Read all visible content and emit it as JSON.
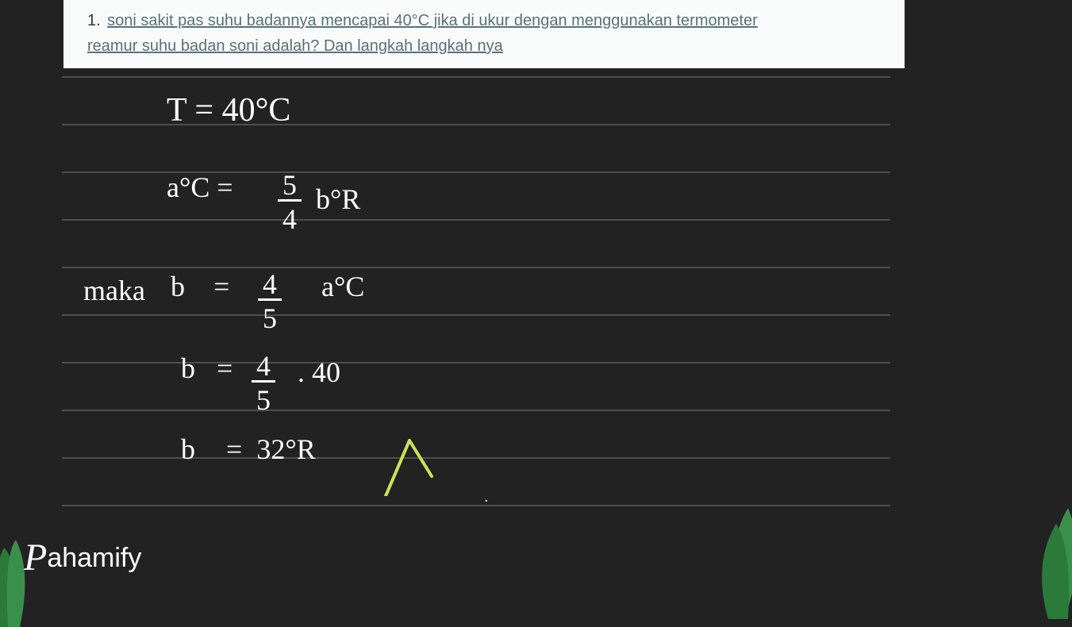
{
  "question": {
    "number": "1.",
    "text_line1": "soni sakit pas suhu badannya mencapai 40°C jika di ukur dengan menggunakan termometer",
    "text_line2": "reamur suhu badan soni adalah? Dan langkah langkah nya"
  },
  "work": {
    "given": "T = 40°C",
    "formula_lhs": "a°C =",
    "formula_frac_num": "5",
    "formula_frac_den": "4",
    "formula_rhs": "b°R",
    "then_label": "maka",
    "step1_lhs": "b",
    "step1_eq": "=",
    "step1_frac_num": "4",
    "step1_frac_den": "5",
    "step1_rhs": "a°C",
    "step2_lhs": "b",
    "step2_eq": "=",
    "step2_frac_num": "4",
    "step2_frac_den": "5",
    "step2_rhs": ". 40",
    "step3_lhs": "b",
    "step3_eq": "=",
    "result": "32°R"
  },
  "logo": "Pahamify"
}
